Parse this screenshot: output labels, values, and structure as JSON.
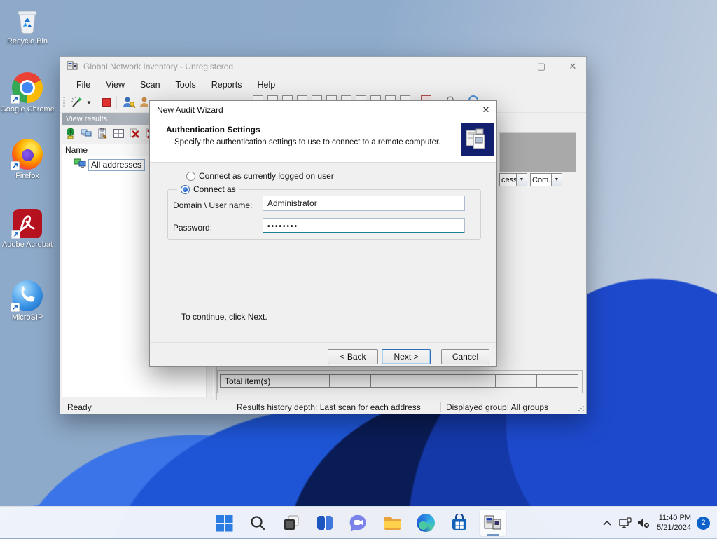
{
  "desktop": {
    "icons": [
      {
        "label": "Recycle Bin"
      },
      {
        "label": "Google Chrome"
      },
      {
        "label": "Firefox"
      },
      {
        "label": "Adobe Acrobat"
      },
      {
        "label": "MicroSIP"
      }
    ]
  },
  "window": {
    "title": "Global Network Inventory - Unregistered",
    "menu": [
      "File",
      "View",
      "Scan",
      "Tools",
      "Reports",
      "Help"
    ],
    "left_panel": {
      "header": "View results",
      "column": "Name",
      "tree_item": "All addresses"
    },
    "right_panel": {
      "filter1": "cess...",
      "filter2": "Com...",
      "footer_label": "Total  item(s)"
    },
    "status": {
      "ready": "Ready",
      "history": "Results history depth: Last scan for each address",
      "group": "Displayed group: All groups"
    }
  },
  "dialog": {
    "title": "New Audit Wizard",
    "close_glyph": "✕",
    "heading": "Authentication Settings",
    "subtitle": "Specify the authentication settings to use to connect to a remote computer.",
    "radio_current": "Connect as currently logged on user",
    "radio_connect_as": "Connect as",
    "domain_label": "Domain \\ User name:",
    "domain_value": "Administrator",
    "password_label": "Password:",
    "password_value": "••••••••",
    "continue_text": "To continue, click Next.",
    "buttons": {
      "back": "< Back",
      "next": "Next >",
      "cancel": "Cancel"
    }
  },
  "taskbar": {
    "time": "11:40 PM",
    "date": "5/21/2024",
    "badge": "2"
  },
  "colors": {
    "accent": "#0d62c9",
    "password_underline": "#1d7f95",
    "wizard_icon_bg": "#121f6e"
  }
}
